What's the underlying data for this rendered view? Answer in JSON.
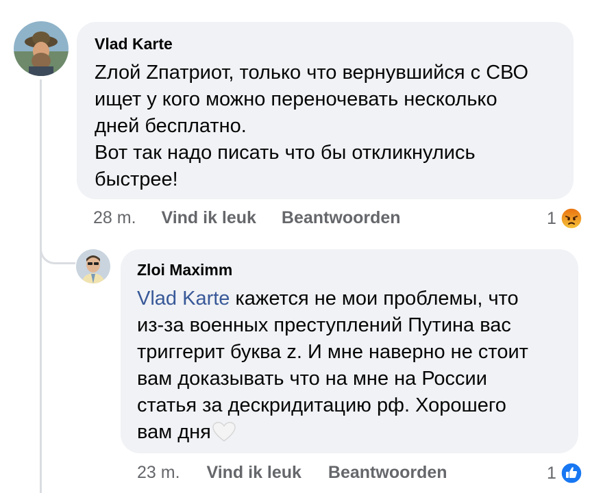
{
  "comments": [
    {
      "author": "Vlad Karte",
      "text_lines": [
        "Zлой Zпатриот, только что вернувшийся с СВО",
        "ищет у кого можно переночевать несколько",
        "дней бесплатно.",
        "Вот так надо писать что бы откликнулись",
        "быстрее!"
      ],
      "time": "28 m.",
      "like_label": "Vind ik leuk",
      "reply_label": "Beantwoorden",
      "reaction_count": "1",
      "reaction_icon": "angry-reaction-icon"
    },
    {
      "author": "Zloi Maximm",
      "mention": "Vlad Karte",
      "text_first": " кажется не мои проблемы, что",
      "text_lines": [
        "из-за военных преступлений Путина вас",
        "триггерит буква z. И мне наверно не стоит",
        "вам доказывать что на мне на России",
        "статья за дескридитацию рф. Хорошего",
        "вам дня"
      ],
      "emoji": "white-heart-icon",
      "time": "23 m.",
      "like_label": "Vind ik leuk",
      "reply_label": "Beantwoorden",
      "reaction_count": "1",
      "reaction_icon": "like-reaction-icon"
    }
  ],
  "colors": {
    "bubble": "#f0f2f5",
    "meta_text": "#65676b",
    "mention": "#385898",
    "like_blue": "#1877f2",
    "angry_top": "#f5c33b",
    "angry_bottom": "#e9710f"
  }
}
